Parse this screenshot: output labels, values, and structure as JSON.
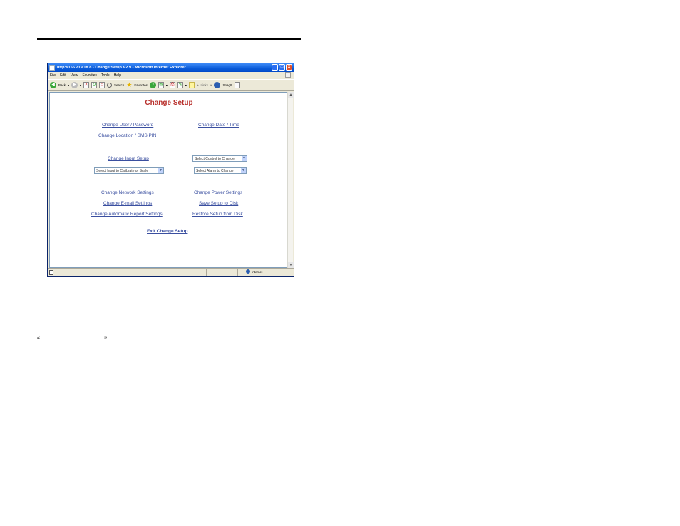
{
  "window": {
    "title": "http://166.219.18.8 - Change Setup V2.9 - Microsoft Internet Explorer",
    "min_label": "_",
    "max_label": "□",
    "close_label": "x"
  },
  "menu": [
    "File",
    "Edit",
    "View",
    "Favorites",
    "Tools",
    "Help"
  ],
  "toolbar": {
    "back": "Back",
    "search": "Search",
    "favorites": "Favorites",
    "links": "Links",
    "snagit": "SnagIt",
    "chevron": "»"
  },
  "page": {
    "title": "Change Setup",
    "links": {
      "user_password": "Change User / Password",
      "date_time": "Change Date / Time",
      "location_sms": "Change Location / SMS PIN",
      "input_setup": "Change Input Setup",
      "network": "Change Network Settings",
      "power": "Change Power Settings",
      "email": "Change E-mail Settings",
      "save_disk": "Save Setup to Disk",
      "auto_report": "Change Automatic Report Settings",
      "restore_disk": "Restore Setup from Disk",
      "exit": "Exit Change Setup"
    },
    "selects": {
      "control": "Select Control to Change",
      "input_calibrate": "Select Input to Calibrate or Scale",
      "alarm": "Select Alarm to Change"
    }
  },
  "status": {
    "zone": "Internet"
  },
  "quotes": {
    "open": "“",
    "close": "”"
  }
}
